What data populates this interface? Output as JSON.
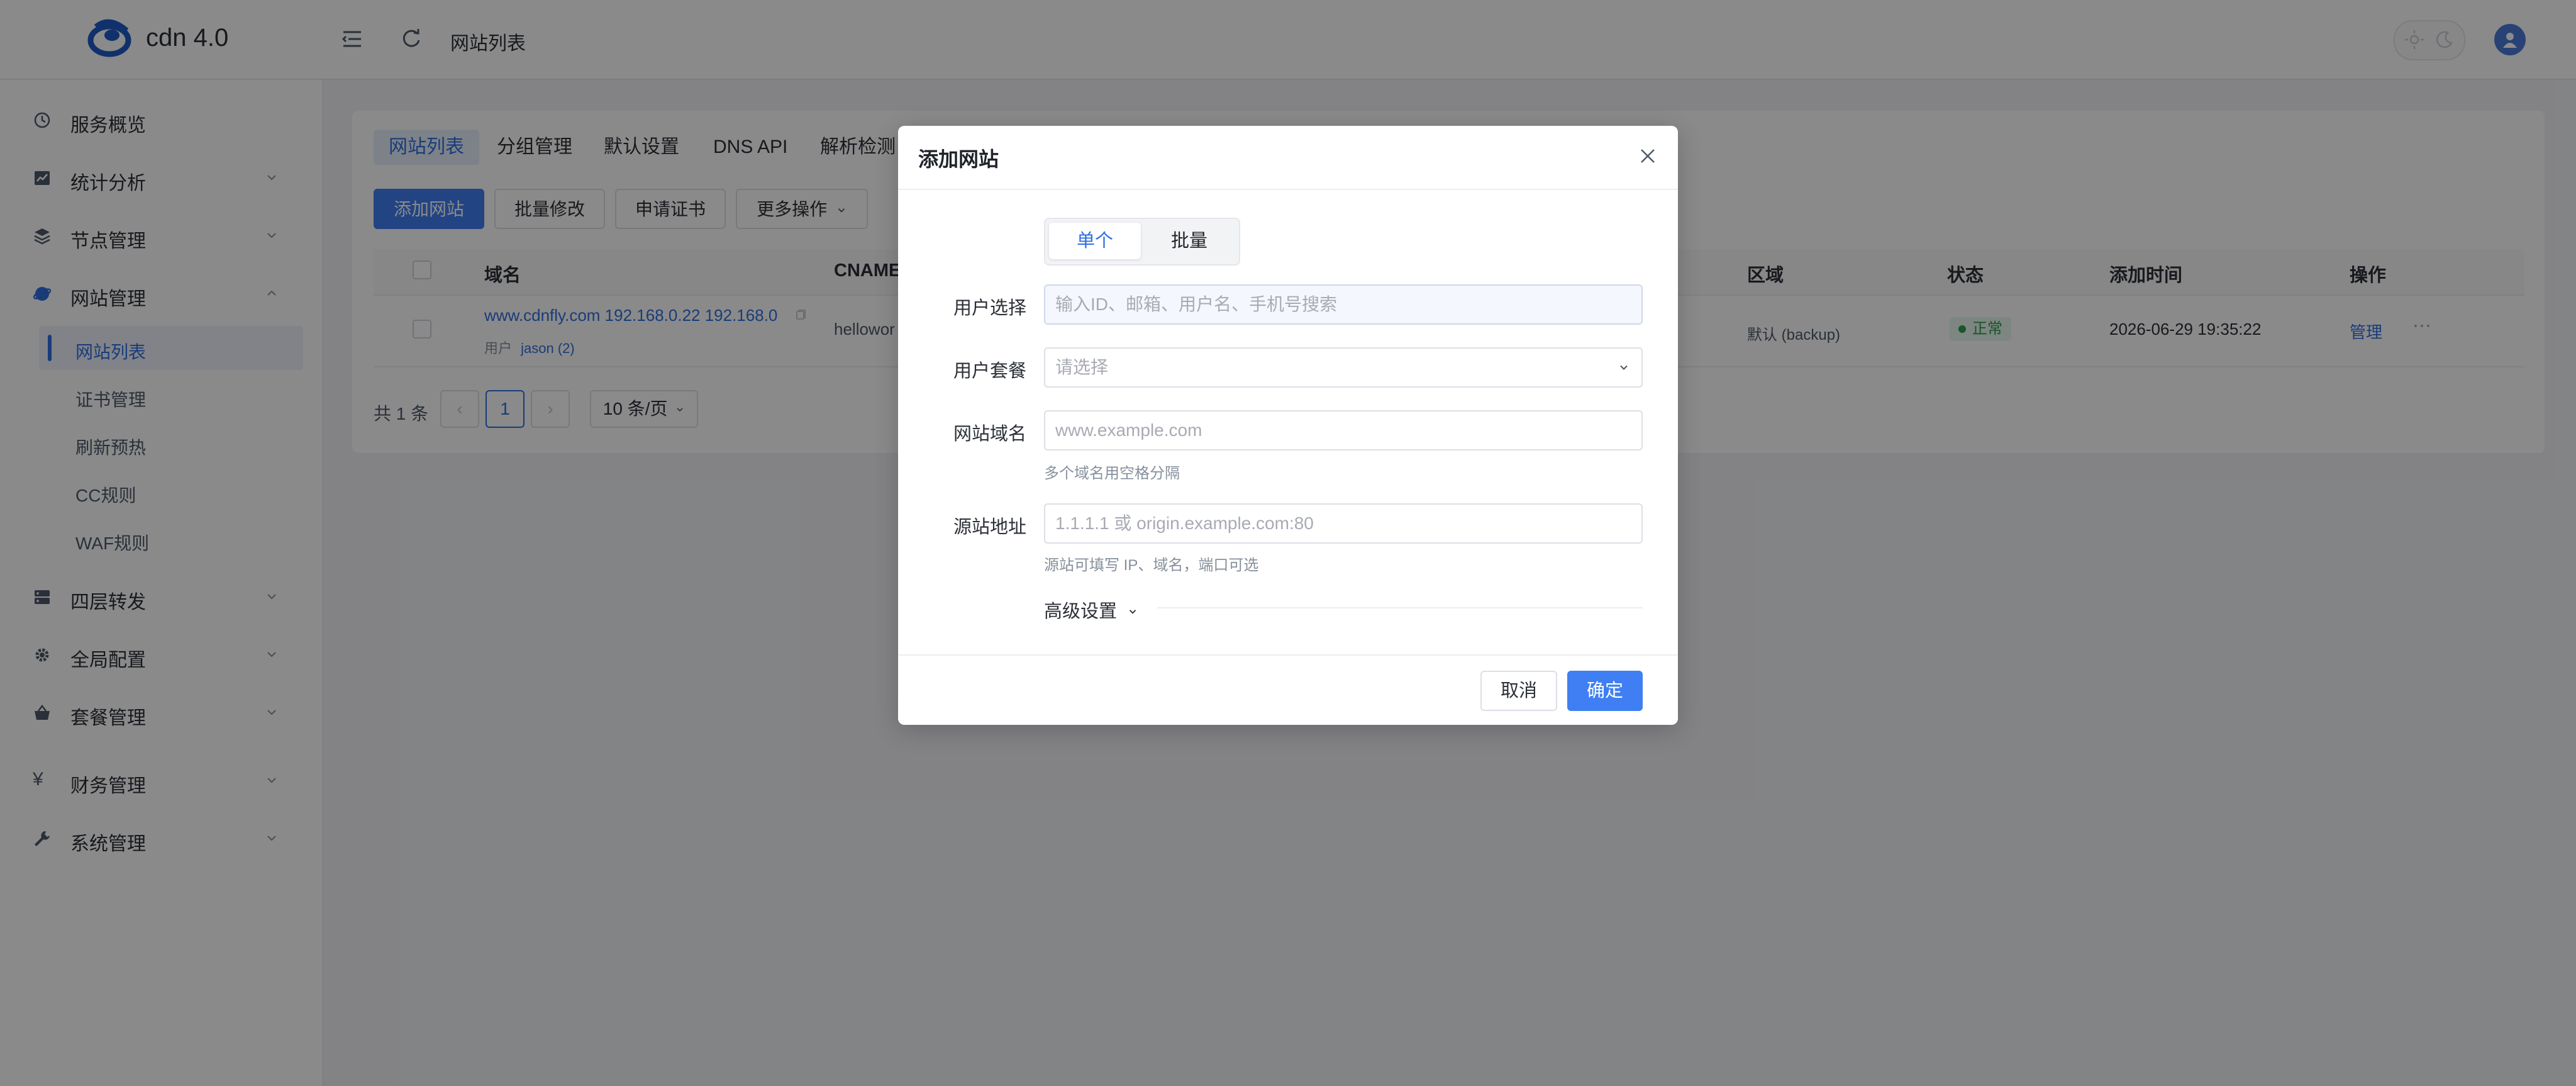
{
  "header": {
    "logo_text": "cdn 4.0",
    "page_title": "网站列表"
  },
  "sidebar": {
    "items": [
      {
        "label": "服务概览",
        "icon": "clock-icon"
      },
      {
        "label": "统计分析",
        "icon": "chart-icon"
      },
      {
        "label": "节点管理",
        "icon": "layers-icon"
      },
      {
        "label": "网站管理",
        "icon": "globe-icon"
      },
      {
        "label": "四层转发",
        "icon": "server-icon"
      },
      {
        "label": "全局配置",
        "icon": "gear-icon"
      },
      {
        "label": "套餐管理",
        "icon": "basket-icon"
      },
      {
        "label": "财务管理",
        "icon": "yen-icon"
      },
      {
        "label": "系统管理",
        "icon": "wrench-icon"
      }
    ],
    "sub_items": [
      "网站列表",
      "证书管理",
      "刷新预热",
      "CC规则",
      "WAF规则"
    ],
    "yen_glyph": "¥"
  },
  "main": {
    "tabs": [
      "网站列表",
      "分组管理",
      "默认设置",
      "DNS API",
      "解析检测"
    ],
    "buttons": {
      "add": "添加网站",
      "batch_edit": "批量修改",
      "apply_cert": "申请证书",
      "more": "更多操作"
    },
    "table": {
      "headers": {
        "domain": "域名",
        "cname": "CNAME",
        "region": "区域",
        "status": "状态",
        "added": "添加时间",
        "actions": "操作"
      },
      "row": {
        "domain": "www.cdnfly.com 192.168.0.22 192.168.0",
        "user_label": "用户",
        "user": "jason (2)",
        "cname": "hellowor",
        "region": "默认 (backup)",
        "status": "正常",
        "added": "2026-06-29 19:35:22",
        "manage": "管理",
        "more": "···"
      }
    },
    "pagination": {
      "total": "共 1 条",
      "prev": "‹",
      "page": "1",
      "next": "›",
      "page_size": "10 条/页"
    }
  },
  "modal": {
    "title": "添加网站",
    "segment": {
      "single": "单个",
      "batch": "批量"
    },
    "fields": {
      "user_label": "用户选择",
      "user_placeholder": "输入ID、邮箱、用户名、手机号搜索",
      "plan_label": "用户套餐",
      "plan_placeholder": "请选择",
      "domain_label": "网站域名",
      "domain_placeholder": "www.example.com",
      "domain_hint": "多个域名用空格分隔",
      "origin_label": "源站地址",
      "origin_placeholder": "1.1.1.1 或 origin.example.com:80",
      "origin_hint": "源站可填写 IP、域名，端口可选"
    },
    "advanced": "高级设置",
    "cancel": "取消",
    "ok": "确定"
  },
  "colors": {
    "primary": "#3f7ff3",
    "success": "#2d9d51",
    "overlay": "rgba(0,0,0,0.46)"
  }
}
